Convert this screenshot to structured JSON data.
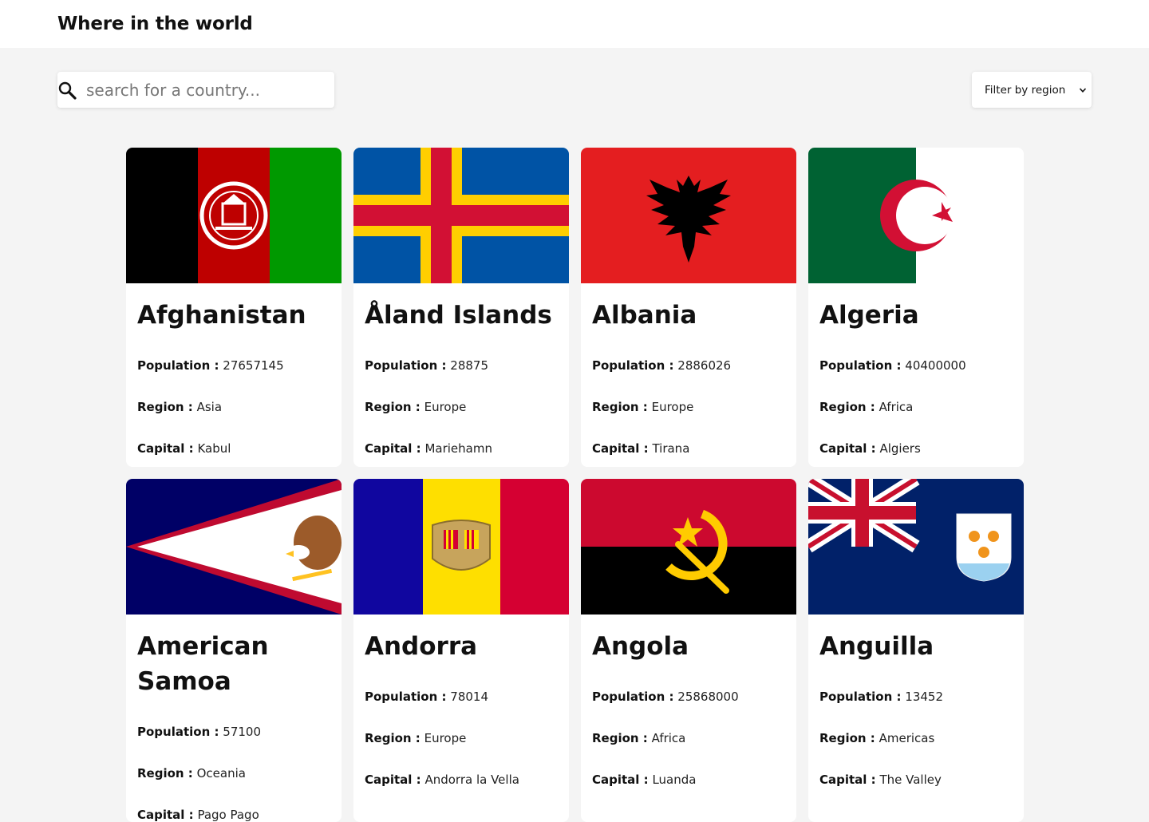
{
  "header": {
    "title": "Where in the world"
  },
  "search": {
    "placeholder": "search for a country..."
  },
  "filter": {
    "label": "Filter by region"
  },
  "labels": {
    "population": "Population :",
    "region": "Region :",
    "capital": "Capital :"
  },
  "countries": [
    {
      "name": "Afghanistan",
      "population": "27657145",
      "region": "Asia",
      "capital": "Kabul",
      "flag_icon": "afghanistan-flag"
    },
    {
      "name": "Åland Islands",
      "population": "28875",
      "region": "Europe",
      "capital": "Mariehamn",
      "flag_icon": "aland-islands-flag"
    },
    {
      "name": "Albania",
      "population": "2886026",
      "region": "Europe",
      "capital": "Tirana",
      "flag_icon": "albania-flag"
    },
    {
      "name": "Algeria",
      "population": "40400000",
      "region": "Africa",
      "capital": "Algiers",
      "flag_icon": "algeria-flag"
    },
    {
      "name": "American Samoa",
      "population": "57100",
      "region": "Oceania",
      "capital": "Pago Pago",
      "flag_icon": "american-samoa-flag"
    },
    {
      "name": "Andorra",
      "population": "78014",
      "region": "Europe",
      "capital": "Andorra la Vella",
      "flag_icon": "andorra-flag"
    },
    {
      "name": "Angola",
      "population": "25868000",
      "region": "Africa",
      "capital": "Luanda",
      "flag_icon": "angola-flag"
    },
    {
      "name": "Anguilla",
      "population": "13452",
      "region": "Americas",
      "capital": "The Valley",
      "flag_icon": "anguilla-flag"
    }
  ]
}
